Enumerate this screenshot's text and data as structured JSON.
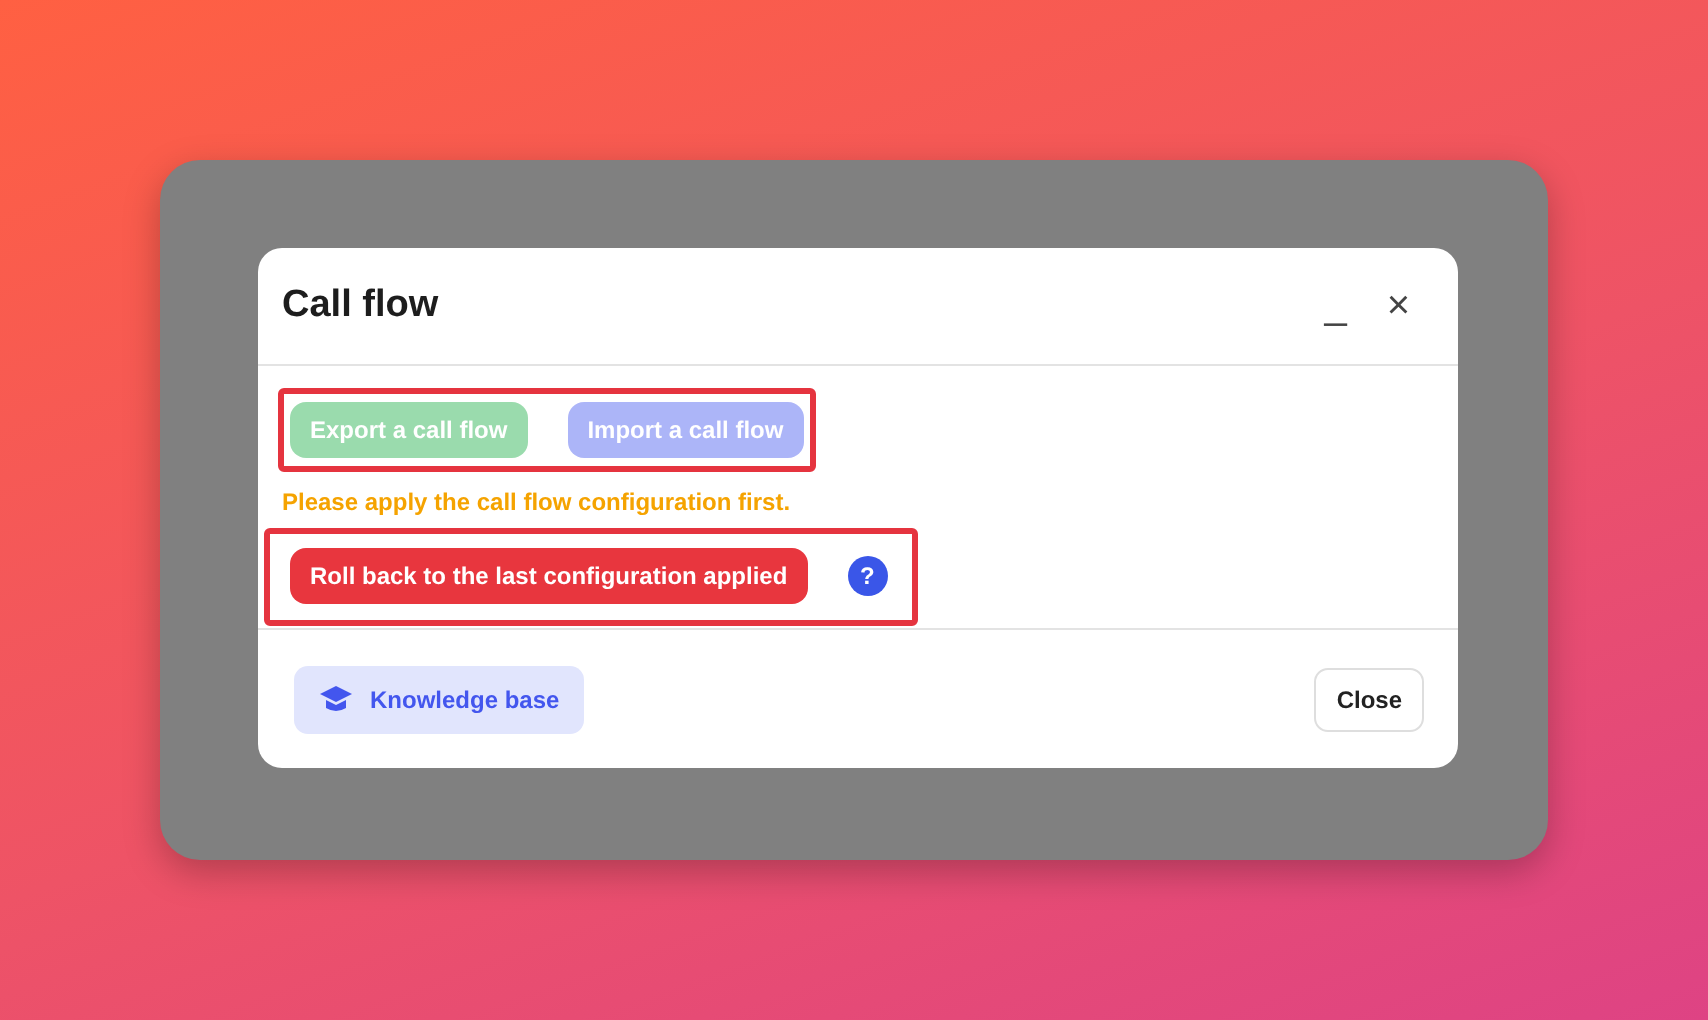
{
  "dialog": {
    "title": "Call flow",
    "minimize_symbol": "_",
    "close_symbol": "×"
  },
  "transfer_group": {
    "highlighted": true,
    "buttons": [
      {
        "label": "Export a call flow",
        "kind": "export",
        "disabled": true
      },
      {
        "label": "Import a call flow",
        "kind": "import",
        "disabled": true
      }
    ]
  },
  "warning": "Please apply the call flow configuration first.",
  "rollback_group": {
    "highlighted": true,
    "button": {
      "label": "Roll back to the last configuration applied",
      "disabled": false
    },
    "help_symbol": "?"
  },
  "footer": {
    "knowledge_base": "Knowledge base",
    "close": "Close"
  }
}
